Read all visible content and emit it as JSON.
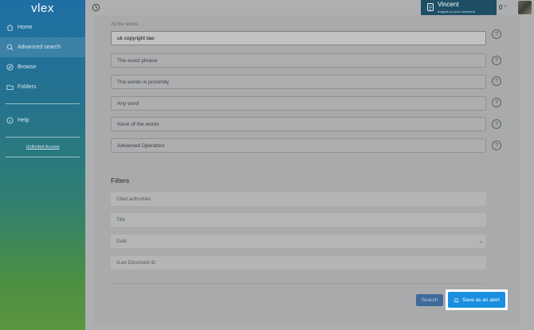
{
  "brand": {
    "logo": "vlex"
  },
  "sidebar": {
    "items": [
      {
        "label": "Home",
        "icon": "home-icon"
      },
      {
        "label": "Advanced search",
        "icon": "search-icon"
      },
      {
        "label": "Browse",
        "icon": "compass-icon"
      },
      {
        "label": "Folders",
        "icon": "folder-icon"
      }
    ],
    "help": {
      "label": "Help",
      "icon": "info-icon"
    },
    "unlimited_access": "Unlimited Access"
  },
  "topbar": {
    "user_name": "Vincent",
    "user_subtitle": "Insights on your document",
    "counter": "0"
  },
  "form": {
    "all_words_label": "All the words",
    "all_words_value": "uk copyright law",
    "exact_phrase_placeholder": "The exact phrase",
    "proximity_placeholder": "The words in proximity",
    "any_word_placeholder": "Any word",
    "none_words_placeholder": "None of the words",
    "operators_placeholder": "Advanced Operators",
    "help_symbol": "?"
  },
  "filters": {
    "title": "Filters",
    "cited_authorities": "Cited authorities",
    "title_field": "Title",
    "date_select": "Date",
    "document_id": "vLex Document ID"
  },
  "actions": {
    "search_label": "Search",
    "alert_label": "Save as an alert"
  },
  "colors": {
    "sidebar_top": "#1f6fa6",
    "sidebar_bottom": "#5a9640",
    "alert_button": "#1a8fe0",
    "search_button": "#3e6a9a",
    "user_card": "#1e4f66"
  }
}
